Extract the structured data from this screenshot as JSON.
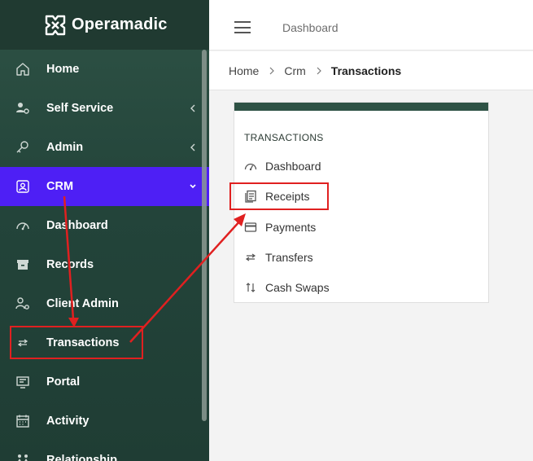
{
  "brand": {
    "name": "Operamadic"
  },
  "sidebar": {
    "items": [
      {
        "label": "Home"
      },
      {
        "label": "Self Service"
      },
      {
        "label": "Admin"
      },
      {
        "label": "CRM"
      },
      {
        "label": "Dashboard"
      },
      {
        "label": "Records"
      },
      {
        "label": "Client Admin"
      },
      {
        "label": "Transactions"
      },
      {
        "label": "Portal"
      },
      {
        "label": "Activity"
      },
      {
        "label": "Relationship"
      }
    ]
  },
  "topbar": {
    "title": "Dashboard"
  },
  "breadcrumb": {
    "items": [
      "Home",
      "Crm",
      "Transactions"
    ]
  },
  "card": {
    "title": "TRANSACTIONS",
    "items": [
      {
        "label": "Dashboard"
      },
      {
        "label": "Receipts"
      },
      {
        "label": "Payments"
      },
      {
        "label": "Transfers"
      },
      {
        "label": "Cash Swaps"
      }
    ]
  },
  "colors": {
    "sidebar": "#2e5245",
    "active": "#4e1ff5",
    "annotation": "#e02020"
  }
}
